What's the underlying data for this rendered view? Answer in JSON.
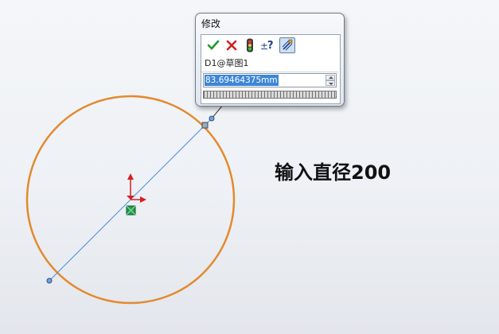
{
  "dialog": {
    "title": "修改",
    "toolbar": {
      "ok_icon": "checkmark-icon",
      "cancel_icon": "x-icon",
      "rebuild_icon": "traffic-light-icon",
      "reverse_icon": "plus-minus-question-icon",
      "mark_icon": "dimension-marker-icon"
    },
    "dimension_name": "D1@草图1",
    "value": "83.69464375mm"
  },
  "annotation": "输入直径200",
  "colors": {
    "circle": "#e38a2d",
    "diameter_line": "#4b8fe0",
    "origin_arrow": "#d62020",
    "center_marker": "#1f9a4a",
    "selection": "#3d86d8"
  }
}
